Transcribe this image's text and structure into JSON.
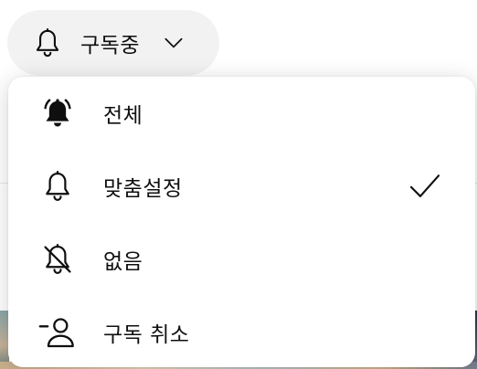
{
  "subscribe_button": {
    "label": "구독중",
    "icon": "bell-icon",
    "chevron": "chevron-down-icon"
  },
  "menu": {
    "items": [
      {
        "label": "전체",
        "icon": "bell-ringing-filled-icon",
        "selected": false
      },
      {
        "label": "맞춤설정",
        "icon": "bell-outline-icon",
        "selected": true
      },
      {
        "label": "없음",
        "icon": "bell-off-icon",
        "selected": false
      },
      {
        "label": "구독 취소",
        "icon": "person-minus-icon",
        "selected": false
      }
    ],
    "check_icon": "checkmark-icon"
  },
  "colors": {
    "text": "#0f0f0f",
    "pill_background": "#f2f2f2",
    "menu_background": "#ffffff"
  }
}
